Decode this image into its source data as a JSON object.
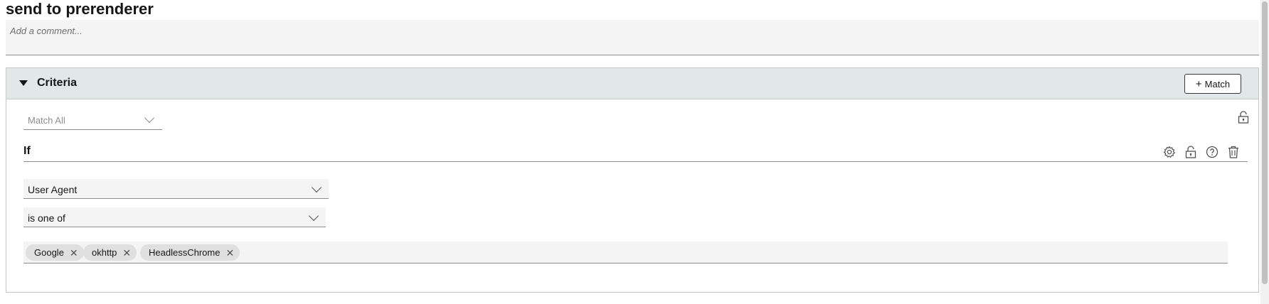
{
  "page": {
    "title": "send to prerenderer",
    "comment_placeholder": "Add a comment..."
  },
  "criteria": {
    "section_title": "Criteria",
    "match_button_label": "Match",
    "match_mode": "Match All",
    "condition": {
      "label": "If",
      "field": "User Agent",
      "operator": "is one of",
      "values": [
        "Google",
        "okhttp",
        "HeadlessChrome"
      ]
    }
  },
  "icons": {
    "expand": "caret-down-icon",
    "add": "plus-icon",
    "unlock": "unlock-icon",
    "settings": "gear-icon",
    "help": "help-icon",
    "delete": "trash-icon",
    "remove_tag": "close-icon",
    "dropdown": "chevron-down-icon"
  }
}
